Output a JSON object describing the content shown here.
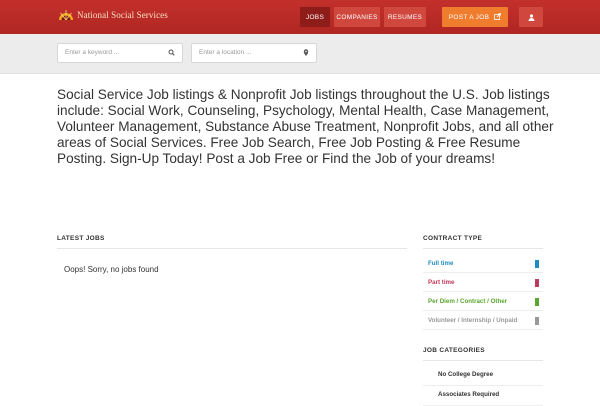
{
  "header": {
    "logo_text": "National Social Services",
    "nav": [
      {
        "label": "Jobs",
        "active": true
      },
      {
        "label": "Companies",
        "active": false
      },
      {
        "label": "Resumes",
        "active": false
      }
    ],
    "post_job_label": "Post a Job",
    "colors": {
      "bar": "#b02622",
      "active_tab": "#8e1c18",
      "post_button": "#f07c2e"
    }
  },
  "search": {
    "keyword_placeholder": "Enter a keyword ...",
    "location_placeholder": "Enter a location ..."
  },
  "intro": "Social Service Job listings & Nonprofit Job listings throughout the U.S. Job listings include: Social Work, Counseling, Psychology, Mental Health, Case Management, Volunteer Management, Substance Abuse Treatment, Nonprofit Jobs, and all other areas of Social Services. Free Job Search, Free Job Posting & Free Resume Posting.  Sign-Up Today! Post a Job Free or Find the Job of your dreams!",
  "latest_jobs": {
    "title": "Latest Jobs",
    "empty_message": "Oops! Sorry, no jobs found"
  },
  "contract_type": {
    "title": "Contract Type",
    "items": [
      {
        "label": "Full time",
        "color": "#1c8bc0"
      },
      {
        "label": "Part time",
        "color": "#c0395a"
      },
      {
        "label": "Per Diem / Contract / Other",
        "color": "#5aa630"
      },
      {
        "label": "Volunteer / Internship / Unpaid",
        "color": "#999999"
      }
    ]
  },
  "job_categories": {
    "title": "Job Categories",
    "items": [
      {
        "label": "No College Degree"
      },
      {
        "label": "Associates Required"
      }
    ]
  }
}
